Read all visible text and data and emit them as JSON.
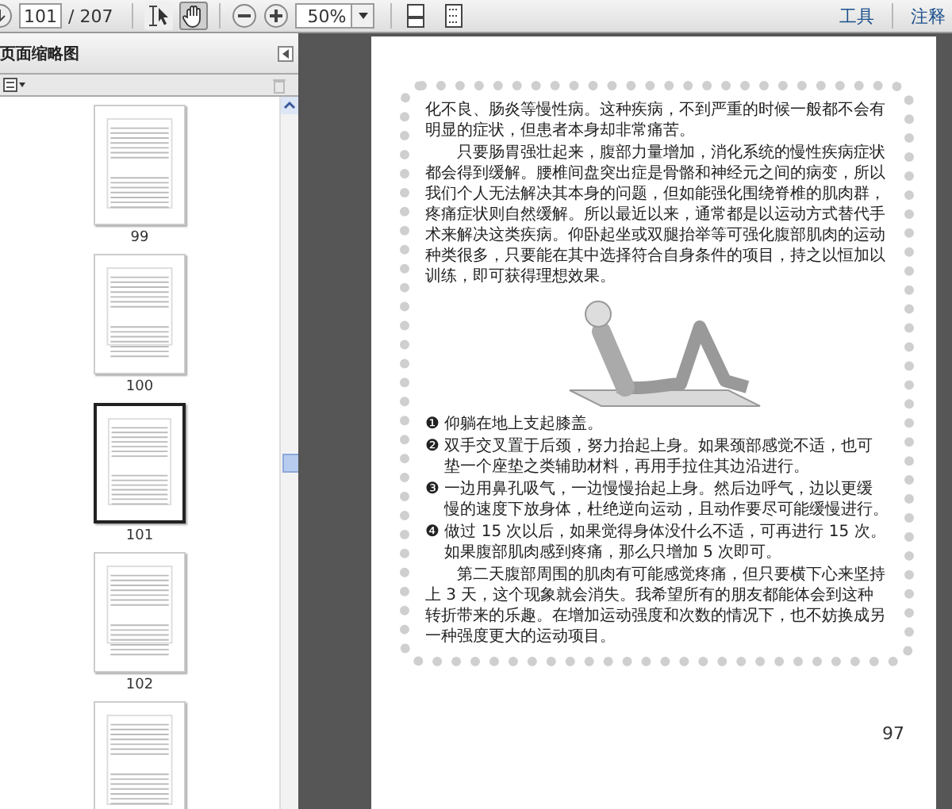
{
  "toolbar": {
    "page_number": "101",
    "page_total": "/ 207",
    "zoom": "50%",
    "tools": [
      {
        "kind": "select",
        "selected": false
      },
      {
        "kind": "hand",
        "selected": true
      }
    ],
    "menu": [
      {
        "label": "工具"
      },
      {
        "label": "注释"
      }
    ]
  },
  "sidebar": {
    "title": "页面缩略图",
    "thumbnails": [
      {
        "label": "99",
        "selected": false
      },
      {
        "label": "100",
        "selected": false
      },
      {
        "label": "101",
        "selected": true
      },
      {
        "label": "102",
        "selected": false
      },
      {
        "selected": false
      }
    ]
  },
  "document": {
    "blocks": [
      {
        "kind": "paragraph",
        "indent": false,
        "text": "化不良、肠炎等慢性病。这种疾病，不到严重的时候一般都不会有明显的症状，但患者本身却非常痛苦。"
      },
      {
        "kind": "paragraph",
        "indent": true,
        "text": "只要肠胃强壮起来，腹部力量增加，消化系统的慢性疾病症状都会得到缓解。腰椎间盘突出症是骨骼和神经元之间的病变，所以我们个人无法解决其本身的问题，但如能强化围绕脊椎的肌肉群，疼痛症状则自然缓解。所以最近以来，通常都是以运动方式替代手术来解决这类疾病。仰卧起坐或双腿抬举等可强化腹部肌肉的运动种类很多，只要能在其中选择符合自身条件的项目，持之以恒加以训练，即可获得理想效果。"
      },
      {
        "kind": "figure"
      },
      {
        "kind": "step",
        "marker": "❶",
        "text": "仰躺在地上支起膝盖。"
      },
      {
        "kind": "step",
        "marker": "❷",
        "text": "双手交叉置于后颈，努力抬起上身。如果颈部感觉不适，也可垫一个座垫之类辅助材料，再用手拉住其边沿进行。"
      },
      {
        "kind": "step",
        "marker": "❸",
        "text": "一边用鼻孔吸气，一边慢慢抬起上身。然后边呼气，边以更缓慢的速度下放身体，杜绝逆向运动，且动作要尽可能缓慢进行。"
      },
      {
        "kind": "step",
        "marker": "❹",
        "text": "做过 15 次以后，如果觉得身体没什么不适，可再进行 15 次。如果腹部肌肉感到疼痛，那么只增加 5 次即可。"
      },
      {
        "kind": "paragraph",
        "indent": true,
        "text": "第二天腹部周围的肌肉有可能感觉疼痛，但只要横下心来坚持上 3 天，这个现象就会消失。我希望所有的朋友都能体会到这种转折带来的乐趣。在增加运动强度和次数的情况下，也不妨换成另一种强度更大的运动项目。"
      }
    ],
    "page_number": "97"
  }
}
